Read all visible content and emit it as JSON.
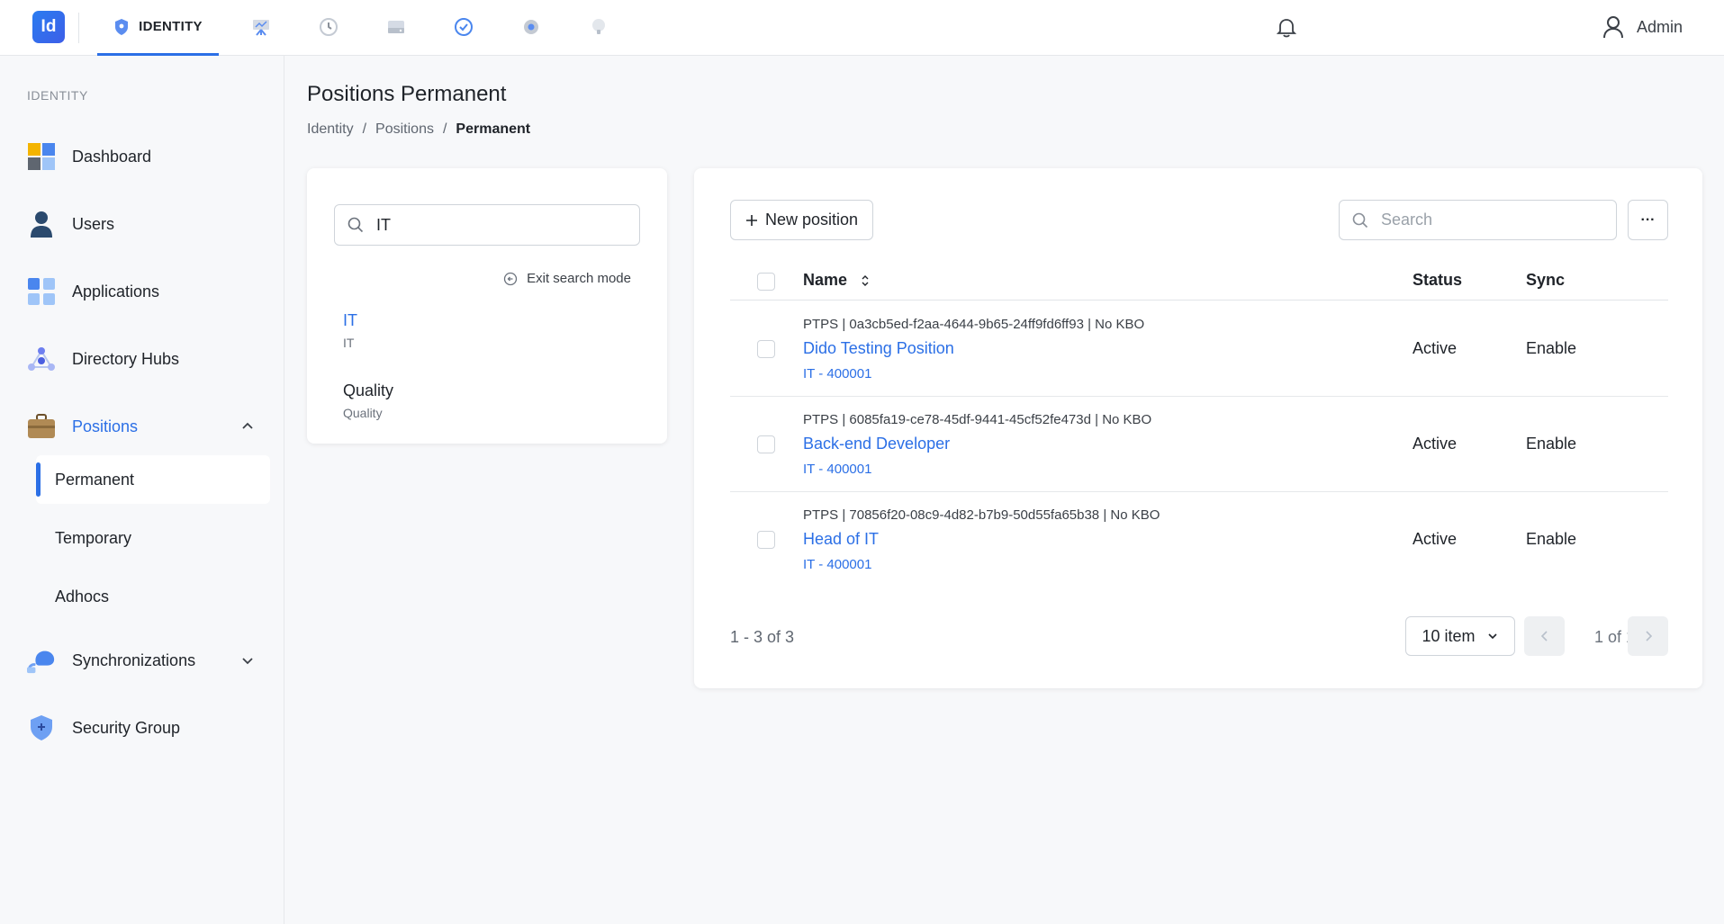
{
  "topbar": {
    "logo": "Id",
    "active_tab": "IDENTITY",
    "icons": [
      "shield-icon",
      "presentation-icon",
      "history-icon",
      "drive-icon",
      "check-badge-icon",
      "gear-icon",
      "bulb-icon"
    ],
    "user_name": "Admin"
  },
  "sidebar": {
    "heading": "IDENTITY",
    "items": [
      {
        "label": "Dashboard",
        "icon": "dashboard-icon"
      },
      {
        "label": "Users",
        "icon": "user-icon"
      },
      {
        "label": "Applications",
        "icon": "apps-icon"
      },
      {
        "label": "Directory Hubs",
        "icon": "hub-icon"
      },
      {
        "label": "Positions",
        "icon": "briefcase-icon"
      },
      {
        "label": "Synchronizations",
        "icon": "cloud-sync-icon"
      },
      {
        "label": "Security Group",
        "icon": "shield-icon"
      }
    ],
    "positions_sub": [
      "Permanent",
      "Temporary",
      "Adhocs"
    ]
  },
  "page": {
    "title": "Positions Permanent",
    "breadcrumb": [
      "Identity",
      "Positions",
      "Permanent"
    ]
  },
  "filter": {
    "search_value": "IT",
    "exit_label": "Exit search mode",
    "results": [
      {
        "title": "IT",
        "subtitle": "IT"
      },
      {
        "title": "Quality",
        "subtitle": "Quality"
      }
    ]
  },
  "table": {
    "new_button": "New position",
    "search_placeholder": "Search",
    "more_label": "···",
    "columns": {
      "name": "Name",
      "status": "Status",
      "sync": "Sync"
    },
    "rows": [
      {
        "meta": "PTPS | 0a3cb5ed-f2aa-4644-9b65-24ff9fd6ff93 | No KBO",
        "title": "Dido Testing Position",
        "sub": "IT - 400001",
        "status": "Active",
        "sync": "Enable"
      },
      {
        "meta": "PTPS | 6085fa19-ce78-45df-9441-45cf52fe473d | No KBO",
        "title": "Back-end Developer",
        "sub": "IT - 400001",
        "status": "Active",
        "sync": "Enable"
      },
      {
        "meta": "PTPS | 70856f20-08c9-4d82-b7b9-50d55fa65b38 | No KBO",
        "title": "Head of IT",
        "sub": "IT - 400001",
        "status": "Active",
        "sync": "Enable"
      }
    ],
    "range": "1 - 3 of 3",
    "page_size": "10 item",
    "page_text": "1 of 1"
  },
  "colors": {
    "accent": "#2b6fe6",
    "text": "#1f2329",
    "muted": "#6b727c"
  }
}
